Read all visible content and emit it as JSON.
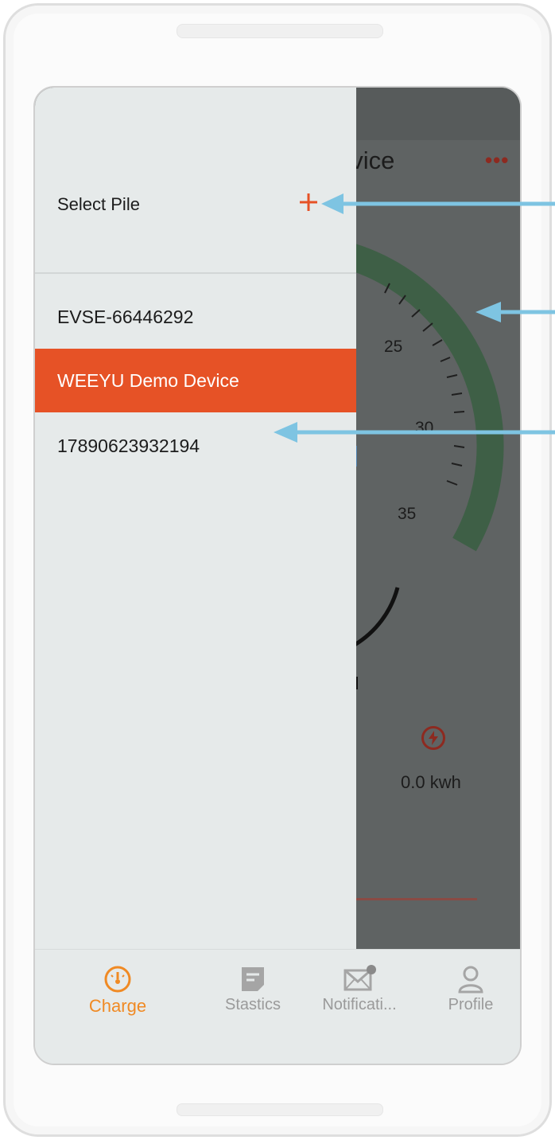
{
  "background_app": {
    "title_fragment": "evice",
    "more_glyph": "•••",
    "gauge_ticks": [
      "25",
      "30",
      "35"
    ],
    "energy_value": "0.0 kwh",
    "energy_icon": "bolt-icon"
  },
  "drawer": {
    "header_title": "Select Pile",
    "add_icon": "plus-icon",
    "piles": [
      {
        "label": "EVSE-66446292",
        "selected": false
      },
      {
        "label": "WEEYU Demo Device",
        "selected": true
      },
      {
        "label": "17890623932194",
        "selected": false
      }
    ]
  },
  "bottom_nav": {
    "items": [
      {
        "label": "Charge",
        "icon": "gauge-icon",
        "active": true
      },
      {
        "label": "Stastics",
        "icon": "document-icon",
        "active": false
      },
      {
        "label": "Notificati...",
        "icon": "mail-icon",
        "active": false
      },
      {
        "label": "Profile",
        "icon": "user-icon",
        "active": false
      }
    ]
  },
  "colors": {
    "accent": "#e65226",
    "nav_active": "#f08a24",
    "annotation_arrow": "#7ec4e2",
    "gauge_arc": "#3e5f46"
  }
}
